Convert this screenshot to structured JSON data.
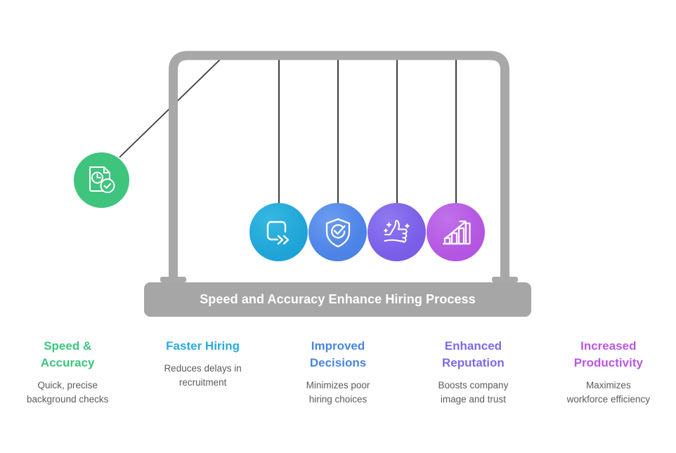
{
  "banner": {
    "text": "Speed and Accuracy Enhance Hiring Process",
    "bg_color": "#a6a6a6",
    "text_color": "#ffffff"
  },
  "frame": {
    "color": "#a8a8a8",
    "string_color": "#3d3d3d"
  },
  "balls": [
    {
      "name": "speed-accuracy",
      "icon": "document-clock-check-icon",
      "color": "#3fc47e",
      "state": "pulled-back"
    },
    {
      "name": "faster-hiring",
      "icon": "fast-forward-arrow-icon",
      "color": "#20a5d8",
      "state": "at-rest"
    },
    {
      "name": "improved-decisions",
      "icon": "shield-check-icon",
      "color": "#4d84e6",
      "state": "at-rest"
    },
    {
      "name": "enhanced-reputation",
      "icon": "thumbs-up-sparkle-icon",
      "color": "#7b5fe8",
      "state": "at-rest"
    },
    {
      "name": "increased-productivity",
      "icon": "bar-chart-growth-icon",
      "color": "#b457e2",
      "state": "at-rest"
    }
  ],
  "captions": [
    {
      "title": "Speed &\nAccuracy",
      "desc": "Quick, precise\nbackground checks",
      "color": "#3fc47e"
    },
    {
      "title": "Faster Hiring",
      "desc": "Reduces delays in\nrecruitment",
      "color": "#29aade"
    },
    {
      "title": "Improved\nDecisions",
      "desc": "Minimizes poor\nhiring choices",
      "color": "#4a84e0"
    },
    {
      "title": "Enhanced\nReputation",
      "desc": "Boosts company\nimage and trust",
      "color": "#7b6ae8"
    },
    {
      "title": "Increased\nProductivity",
      "desc": "Maximizes\nworkforce efficiency",
      "color": "#b857e0"
    }
  ]
}
